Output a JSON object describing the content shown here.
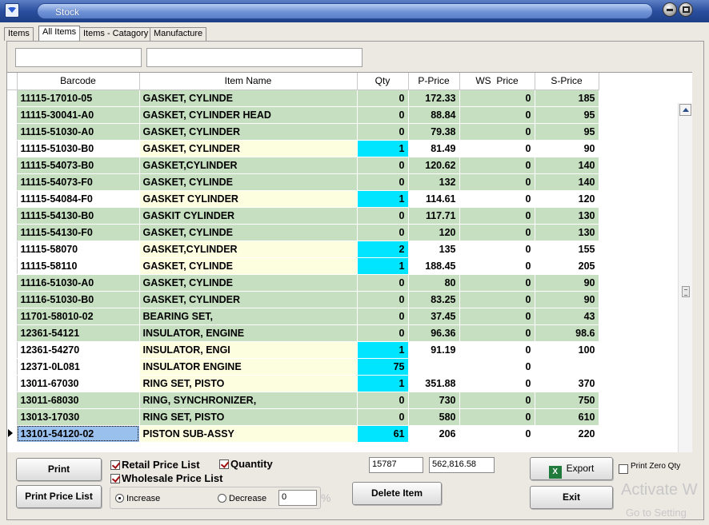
{
  "window": {
    "title": "Stock"
  },
  "tabs": [
    {
      "label": "Items"
    },
    {
      "label": "All Items"
    },
    {
      "label": "Items - Catagory"
    },
    {
      "label": "Manufacture"
    }
  ],
  "filters": {
    "barcode": "",
    "name": ""
  },
  "table": {
    "columns": [
      "Barcode",
      "Item Name",
      "Qty",
      "P-Price",
      "WS  Price",
      "S-Price"
    ],
    "rows": [
      {
        "barcode": "11115-17010-05",
        "name": "GASKET, CYLINDE",
        "qty": "0",
        "pprice": "172.33",
        "ws": "0",
        "sprice": "185"
      },
      {
        "barcode": "11115-30041-A0",
        "name": "GASKET, CYLINDER HEAD",
        "qty": "0",
        "pprice": "88.84",
        "ws": "0",
        "sprice": "95"
      },
      {
        "barcode": "11115-51030-A0",
        "name": "GASKET, CYLINDER",
        "qty": "0",
        "pprice": "79.38",
        "ws": "0",
        "sprice": "95"
      },
      {
        "barcode": "11115-51030-B0",
        "name": "GASKET, CYLINDER",
        "qty": "1",
        "pprice": "81.49",
        "ws": "0",
        "sprice": "90"
      },
      {
        "barcode": "11115-54073-B0",
        "name": "GASKET,CYLINDER",
        "qty": "0",
        "pprice": "120.62",
        "ws": "0",
        "sprice": "140"
      },
      {
        "barcode": "11115-54073-F0",
        "name": "GASKET, CYLINDE",
        "qty": "0",
        "pprice": "132",
        "ws": "0",
        "sprice": "140"
      },
      {
        "barcode": "11115-54084-F0",
        "name": "GASKET CYLINDER",
        "qty": "1",
        "pprice": "114.61",
        "ws": "0",
        "sprice": "120"
      },
      {
        "barcode": "11115-54130-B0",
        "name": "GASKIT CYLINDER",
        "qty": "0",
        "pprice": "117.71",
        "ws": "0",
        "sprice": "130"
      },
      {
        "barcode": "11115-54130-F0",
        "name": "GASKET, CYLINDE",
        "qty": "0",
        "pprice": "120",
        "ws": "0",
        "sprice": "130"
      },
      {
        "barcode": "11115-58070",
        "name": "GASKET,CYLINDER",
        "qty": "2",
        "pprice": "135",
        "ws": "0",
        "sprice": "155"
      },
      {
        "barcode": "11115-58110",
        "name": "GASKET, CYLINDE",
        "qty": "1",
        "pprice": "188.45",
        "ws": "0",
        "sprice": "205"
      },
      {
        "barcode": "11116-51030-A0",
        "name": "GASKET, CYLINDE",
        "qty": "0",
        "pprice": "80",
        "ws": "0",
        "sprice": "90"
      },
      {
        "barcode": "11116-51030-B0",
        "name": "GASKET, CYLINDER",
        "qty": "0",
        "pprice": "83.25",
        "ws": "0",
        "sprice": "90"
      },
      {
        "barcode": "11701-58010-02",
        "name": "BEARING SET,",
        "qty": "0",
        "pprice": "37.45",
        "ws": "0",
        "sprice": "43"
      },
      {
        "barcode": "12361-54121",
        "name": "INSULATOR, ENGINE",
        "qty": "0",
        "pprice": "96.36",
        "ws": "0",
        "sprice": "98.6"
      },
      {
        "barcode": "12361-54270",
        "name": "INSULATOR, ENGI",
        "qty": "1",
        "pprice": "91.19",
        "ws": "0",
        "sprice": "100"
      },
      {
        "barcode": "12371-0L081",
        "name": "INSULATOR ENGINE",
        "qty": "75",
        "pprice": "",
        "ws": "0",
        "sprice": ""
      },
      {
        "barcode": "13011-67030",
        "name": "RING SET, PISTO",
        "qty": "1",
        "pprice": "351.88",
        "ws": "0",
        "sprice": "370"
      },
      {
        "barcode": "13011-68030",
        "name": "RING, SYNCHRONIZER,",
        "qty": "0",
        "pprice": "730",
        "ws": "0",
        "sprice": "750"
      },
      {
        "barcode": "13013-17030",
        "name": "RING SET, PISTO",
        "qty": "0",
        "pprice": "580",
        "ws": "0",
        "sprice": "610"
      },
      {
        "barcode": "13101-54120-02",
        "name": "PISTON SUB-ASSY",
        "qty": "61",
        "pprice": "206",
        "ws": "0",
        "sprice": "220"
      }
    ]
  },
  "controls": {
    "print_label": "Print",
    "print_price_list_label": "Print Price List",
    "retail_label": "Retail Price List",
    "quantity_label": "Quantity",
    "wholesale_label": "Wholesale Price List",
    "increase_label": "Increase",
    "decrease_label": "Decrease",
    "percent_value": "0",
    "percent_sign": "%",
    "total_qty": "15787",
    "total_value": "562,816.58",
    "delete_label": "Delete Item",
    "export_label": "Export",
    "exit_label": "Exit",
    "print_zero_label": "Print Zero Qty"
  },
  "watermark": {
    "line1": "Activate W",
    "line2": "Go to Setting"
  },
  "colors": {
    "green_row": "#c5dfc0",
    "qty_highlight": "#00e5ff",
    "name_highlight": "#fdfde0",
    "title_blue": "#2a4f9e"
  }
}
